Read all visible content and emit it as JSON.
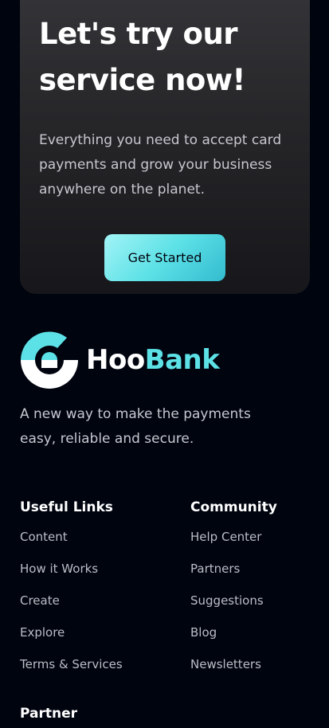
{
  "cta": {
    "title": "Let's try our service now!",
    "text": "Everything you need to accept card payments and grow your business anywhere on the planet.",
    "button_label": "Get Started"
  },
  "brand": {
    "name_part1": "Hoo",
    "name_part2": "Bank",
    "tagline": "A new way to make the payments easy, reliable and secure.",
    "accent_color": "#5ce1e6",
    "logo_icon": "hoobank-logo-icon"
  },
  "footer": {
    "useful_links": {
      "heading": "Useful Links",
      "items": [
        {
          "label": "Content"
        },
        {
          "label": "How it Works"
        },
        {
          "label": "Create"
        },
        {
          "label": "Explore"
        },
        {
          "label": "Terms & Services"
        }
      ]
    },
    "community": {
      "heading": "Community",
      "items": [
        {
          "label": "Help Center"
        },
        {
          "label": "Partners"
        },
        {
          "label": "Suggestions"
        },
        {
          "label": "Blog"
        },
        {
          "label": "Newsletters"
        }
      ]
    },
    "partner": {
      "heading": "Partner"
    }
  }
}
